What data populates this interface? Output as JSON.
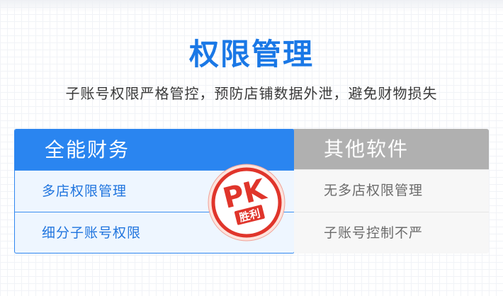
{
  "heading": {
    "title": "权限管理",
    "subtitle": "子账号权限严格管控，预防店铺数据外泄，避免财物损失"
  },
  "comparison": {
    "left": {
      "header": "全能财务",
      "rows": [
        "多店权限管理",
        "细分子账号权限"
      ]
    },
    "right": {
      "header": "其他软件",
      "rows": [
        "无多店权限管理",
        "子账号控制不严"
      ]
    }
  },
  "badge": {
    "main": "PK",
    "sub": "胜利",
    "color": "#e0352b"
  },
  "colors": {
    "accent": "#1a78e6",
    "left_header_bg": "#2a85f0",
    "right_header_bg": "#b0b0b0"
  }
}
